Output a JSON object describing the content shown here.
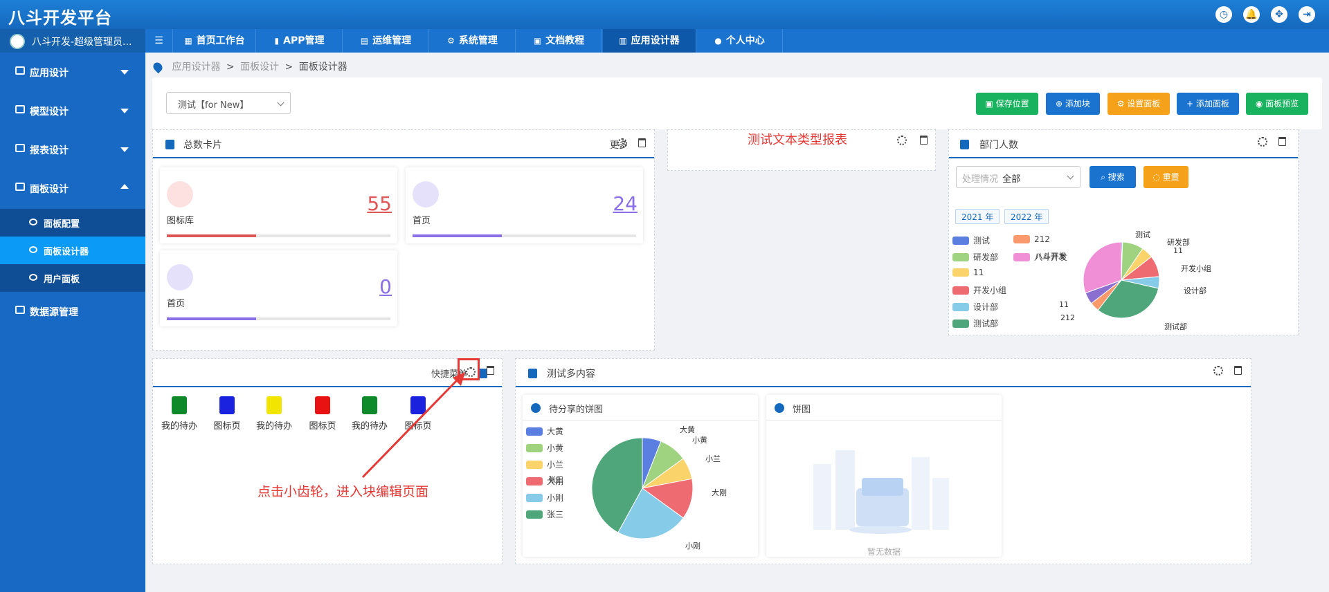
{
  "app": {
    "title": "八斗开发平台"
  },
  "user": {
    "name": "八斗开发-超级管理员..."
  },
  "nav": {
    "tabs": [
      {
        "label": "首页工作台"
      },
      {
        "label": "APP管理"
      },
      {
        "label": "运维管理"
      },
      {
        "label": "系统管理"
      },
      {
        "label": "文档教程"
      },
      {
        "label": "应用设计器"
      },
      {
        "label": "个人中心"
      }
    ]
  },
  "sidebar": {
    "items": [
      {
        "label": "应用设计"
      },
      {
        "label": "模型设计"
      },
      {
        "label": "报表设计"
      },
      {
        "label": "面板设计"
      },
      {
        "label": "数据源管理"
      }
    ],
    "sub": [
      {
        "label": "面板配置"
      },
      {
        "label": "面板设计器"
      },
      {
        "label": "用户面板"
      }
    ]
  },
  "breadcrumb": {
    "items": [
      "应用设计器",
      "面板设计",
      "面板设计器"
    ],
    "sep": ">"
  },
  "toolbar": {
    "select_value": "测试【for New】",
    "buttons": [
      {
        "label": "保存位置",
        "color": "#19b35f"
      },
      {
        "label": "添加块",
        "color": "#1a73cf"
      },
      {
        "label": "设置面板",
        "color": "#f5a21a"
      },
      {
        "label": "添加面板",
        "color": "#1a73cf"
      },
      {
        "label": "面板预览",
        "color": "#19b35f"
      }
    ]
  },
  "panels": {
    "total_cards": {
      "title": "总数卡片",
      "more": "更多",
      "cards": [
        {
          "label": "图标库",
          "value": "55",
          "color": "#e05555",
          "progress": 0.4
        },
        {
          "label": "首页",
          "value": "24",
          "color": "#8b6fe8",
          "progress": 0.4
        },
        {
          "label": "首页",
          "value": "0",
          "color": "#8b6fe8",
          "progress": 0.4
        }
      ]
    },
    "text_report": {
      "title": "测试文本类型报表"
    },
    "dept": {
      "title": "部门人数",
      "filter_placeholder": "处理情况",
      "filter_value": "全部",
      "search": "搜索",
      "reset": "重置",
      "years": [
        "2021 年",
        "2022 年"
      ],
      "legend": [
        {
          "name": "测试",
          "color": "#5b7fe0"
        },
        {
          "name": "212",
          "color": "#fa9a6c"
        },
        {
          "name": "研发部",
          "color": "#9fd37f"
        },
        {
          "name": "八斗开发",
          "color": "#f08fd5"
        },
        {
          "name": "11",
          "color": "#fbd36b"
        },
        {
          "name": "开发小组",
          "color": "#ef6b72"
        },
        {
          "name": "设计部",
          "color": "#86cbe8"
        },
        {
          "name": "测试部",
          "color": "#4fa67a"
        }
      ],
      "pie_labels": [
        "测试",
        "研发部",
        "11",
        "开发小组",
        "设计部",
        "测试部",
        "212",
        "11",
        "八斗开发"
      ]
    },
    "quick": {
      "title": "快捷菜单",
      "items": [
        {
          "label": "我的待办",
          "color": "#0f8a2a"
        },
        {
          "label": "图标页",
          "color": "#1a22e0"
        },
        {
          "label": "我的待办",
          "color": "#f2e600"
        },
        {
          "label": "图标页",
          "color": "#e81212"
        },
        {
          "label": "我的待办",
          "color": "#0f8a2a"
        },
        {
          "label": "图标页",
          "color": "#1a22e0"
        }
      ]
    },
    "multi": {
      "title": "测试多内容",
      "sub1": {
        "title": "待分享的饼图",
        "legend": [
          {
            "name": "大黄",
            "color": "#5b7fe0"
          },
          {
            "name": "小黄",
            "color": "#9fd37f"
          },
          {
            "name": "小兰",
            "color": "#fbd36b"
          },
          {
            "name": "大刚",
            "color": "#ef6b72"
          },
          {
            "name": "小刚",
            "color": "#86cbe8"
          },
          {
            "name": "张三",
            "color": "#4fa67a"
          }
        ],
        "pie_labels": [
          "大黄",
          "小黄",
          "小兰",
          "大刚",
          "小刚"
        ],
        "overlap_label": "张三"
      },
      "sub2": {
        "title": "饼图",
        "empty": "暂无数据"
      }
    }
  },
  "annotation": {
    "text": "点击小齿轮，进入块编辑页面"
  }
}
